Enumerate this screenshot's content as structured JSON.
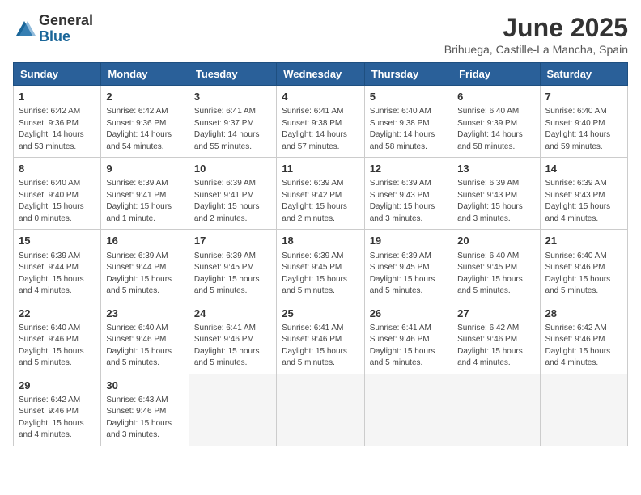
{
  "logo": {
    "general": "General",
    "blue": "Blue"
  },
  "title": "June 2025",
  "location": "Brihuega, Castille-La Mancha, Spain",
  "days_of_week": [
    "Sunday",
    "Monday",
    "Tuesday",
    "Wednesday",
    "Thursday",
    "Friday",
    "Saturday"
  ],
  "weeks": [
    [
      {
        "day": 1,
        "sunrise": "6:42 AM",
        "sunset": "9:36 PM",
        "daylight": "14 hours and 53 minutes."
      },
      {
        "day": 2,
        "sunrise": "6:42 AM",
        "sunset": "9:36 PM",
        "daylight": "14 hours and 54 minutes."
      },
      {
        "day": 3,
        "sunrise": "6:41 AM",
        "sunset": "9:37 PM",
        "daylight": "14 hours and 55 minutes."
      },
      {
        "day": 4,
        "sunrise": "6:41 AM",
        "sunset": "9:38 PM",
        "daylight": "14 hours and 57 minutes."
      },
      {
        "day": 5,
        "sunrise": "6:40 AM",
        "sunset": "9:38 PM",
        "daylight": "14 hours and 58 minutes."
      },
      {
        "day": 6,
        "sunrise": "6:40 AM",
        "sunset": "9:39 PM",
        "daylight": "14 hours and 58 minutes."
      },
      {
        "day": 7,
        "sunrise": "6:40 AM",
        "sunset": "9:40 PM",
        "daylight": "14 hours and 59 minutes."
      }
    ],
    [
      {
        "day": 8,
        "sunrise": "6:40 AM",
        "sunset": "9:40 PM",
        "daylight": "15 hours and 0 minutes."
      },
      {
        "day": 9,
        "sunrise": "6:39 AM",
        "sunset": "9:41 PM",
        "daylight": "15 hours and 1 minute."
      },
      {
        "day": 10,
        "sunrise": "6:39 AM",
        "sunset": "9:41 PM",
        "daylight": "15 hours and 2 minutes."
      },
      {
        "day": 11,
        "sunrise": "6:39 AM",
        "sunset": "9:42 PM",
        "daylight": "15 hours and 2 minutes."
      },
      {
        "day": 12,
        "sunrise": "6:39 AM",
        "sunset": "9:43 PM",
        "daylight": "15 hours and 3 minutes."
      },
      {
        "day": 13,
        "sunrise": "6:39 AM",
        "sunset": "9:43 PM",
        "daylight": "15 hours and 3 minutes."
      },
      {
        "day": 14,
        "sunrise": "6:39 AM",
        "sunset": "9:43 PM",
        "daylight": "15 hours and 4 minutes."
      }
    ],
    [
      {
        "day": 15,
        "sunrise": "6:39 AM",
        "sunset": "9:44 PM",
        "daylight": "15 hours and 4 minutes."
      },
      {
        "day": 16,
        "sunrise": "6:39 AM",
        "sunset": "9:44 PM",
        "daylight": "15 hours and 5 minutes."
      },
      {
        "day": 17,
        "sunrise": "6:39 AM",
        "sunset": "9:45 PM",
        "daylight": "15 hours and 5 minutes."
      },
      {
        "day": 18,
        "sunrise": "6:39 AM",
        "sunset": "9:45 PM",
        "daylight": "15 hours and 5 minutes."
      },
      {
        "day": 19,
        "sunrise": "6:39 AM",
        "sunset": "9:45 PM",
        "daylight": "15 hours and 5 minutes."
      },
      {
        "day": 20,
        "sunrise": "6:40 AM",
        "sunset": "9:45 PM",
        "daylight": "15 hours and 5 minutes."
      },
      {
        "day": 21,
        "sunrise": "6:40 AM",
        "sunset": "9:46 PM",
        "daylight": "15 hours and 5 minutes."
      }
    ],
    [
      {
        "day": 22,
        "sunrise": "6:40 AM",
        "sunset": "9:46 PM",
        "daylight": "15 hours and 5 minutes."
      },
      {
        "day": 23,
        "sunrise": "6:40 AM",
        "sunset": "9:46 PM",
        "daylight": "15 hours and 5 minutes."
      },
      {
        "day": 24,
        "sunrise": "6:41 AM",
        "sunset": "9:46 PM",
        "daylight": "15 hours and 5 minutes."
      },
      {
        "day": 25,
        "sunrise": "6:41 AM",
        "sunset": "9:46 PM",
        "daylight": "15 hours and 5 minutes."
      },
      {
        "day": 26,
        "sunrise": "6:41 AM",
        "sunset": "9:46 PM",
        "daylight": "15 hours and 5 minutes."
      },
      {
        "day": 27,
        "sunrise": "6:42 AM",
        "sunset": "9:46 PM",
        "daylight": "15 hours and 4 minutes."
      },
      {
        "day": 28,
        "sunrise": "6:42 AM",
        "sunset": "9:46 PM",
        "daylight": "15 hours and 4 minutes."
      }
    ],
    [
      {
        "day": 29,
        "sunrise": "6:42 AM",
        "sunset": "9:46 PM",
        "daylight": "15 hours and 4 minutes."
      },
      {
        "day": 30,
        "sunrise": "6:43 AM",
        "sunset": "9:46 PM",
        "daylight": "15 hours and 3 minutes."
      },
      null,
      null,
      null,
      null,
      null
    ]
  ]
}
